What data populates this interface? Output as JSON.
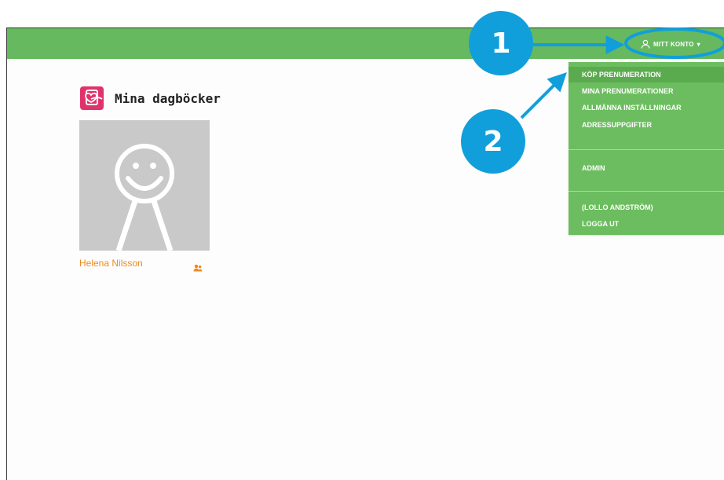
{
  "header": {
    "account_label": "MITT KONTO",
    "account_caret": "▾"
  },
  "account_menu": {
    "items": [
      {
        "label": "KÖP PRENUMERATION",
        "active": true
      },
      {
        "label": "MINA PRENUMERATIONER"
      },
      {
        "label": "ALLMÄNNA INSTÄLLNINGAR"
      },
      {
        "label": "ADRESSUPPGIFTER"
      },
      {
        "label": "ADMIN"
      },
      {
        "label": "(LOLLO ANDSTRÖM)"
      },
      {
        "label": "LOGGA UT"
      }
    ]
  },
  "main": {
    "title": "Mina dagböcker",
    "diaries": [
      {
        "name": "Helena Nilsson"
      }
    ]
  },
  "callouts": [
    "1",
    "2"
  ],
  "colors": {
    "topbar": "#66b95f",
    "menu": "#6cbd5f",
    "menu_active": "#5aab4e",
    "callout": "#119fdb",
    "logo": "#e0336b",
    "name": "#ef8a1e"
  },
  "icons": {
    "account": "user-icon",
    "logo": "diary-heart-logo",
    "share": "share-users-icon",
    "avatar": "smiley-avatar"
  }
}
